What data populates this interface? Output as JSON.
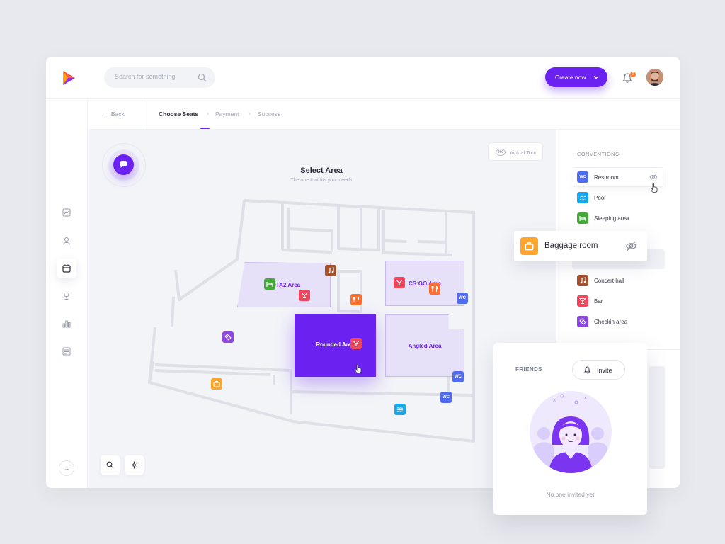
{
  "header": {
    "search_placeholder": "Search for something",
    "create_label": "Create now",
    "notification_count": "2"
  },
  "breadcrumb": {
    "back": "←  Back",
    "steps": [
      "Choose Seats",
      "Payment",
      "Success"
    ]
  },
  "map": {
    "virtual_tour": "Virtual Tour",
    "virtual_tour_badge": "360",
    "title": "Select Area",
    "subtitle": "The one that fits your needs",
    "zones": {
      "dota2": "DOTA2 Area",
      "csgo": "CS:GO Area",
      "rounded": "Rounded Area",
      "angled": "Angled Area"
    },
    "wc": "WC"
  },
  "conventions": {
    "title": "CONVENTIONS",
    "items": [
      {
        "label": "Restroom",
        "icon": "WC",
        "color": "#4f6bf0"
      },
      {
        "label": "Pool",
        "icon": "pool-icon",
        "color": "#1aa7ea"
      },
      {
        "label": "Sleeping area",
        "icon": "bed-icon",
        "color": "#47a83a"
      },
      {
        "label": "Concert hall",
        "icon": "music-icon",
        "color": "#a4502d"
      },
      {
        "label": "Bar",
        "icon": "cocktail-icon",
        "color": "#f0465c"
      },
      {
        "label": "Checkin area",
        "icon": "ticket-icon",
        "color": "#8e46e0"
      }
    ]
  },
  "baggage": {
    "label": "Baggage room",
    "color": "#ffa52c"
  },
  "friends": {
    "title": "FRIENDS",
    "invite": "Invite",
    "empty": "No one invited yet"
  },
  "colors": {
    "accent": "#6b21ef",
    "restaurant": "#ff6e2f"
  }
}
